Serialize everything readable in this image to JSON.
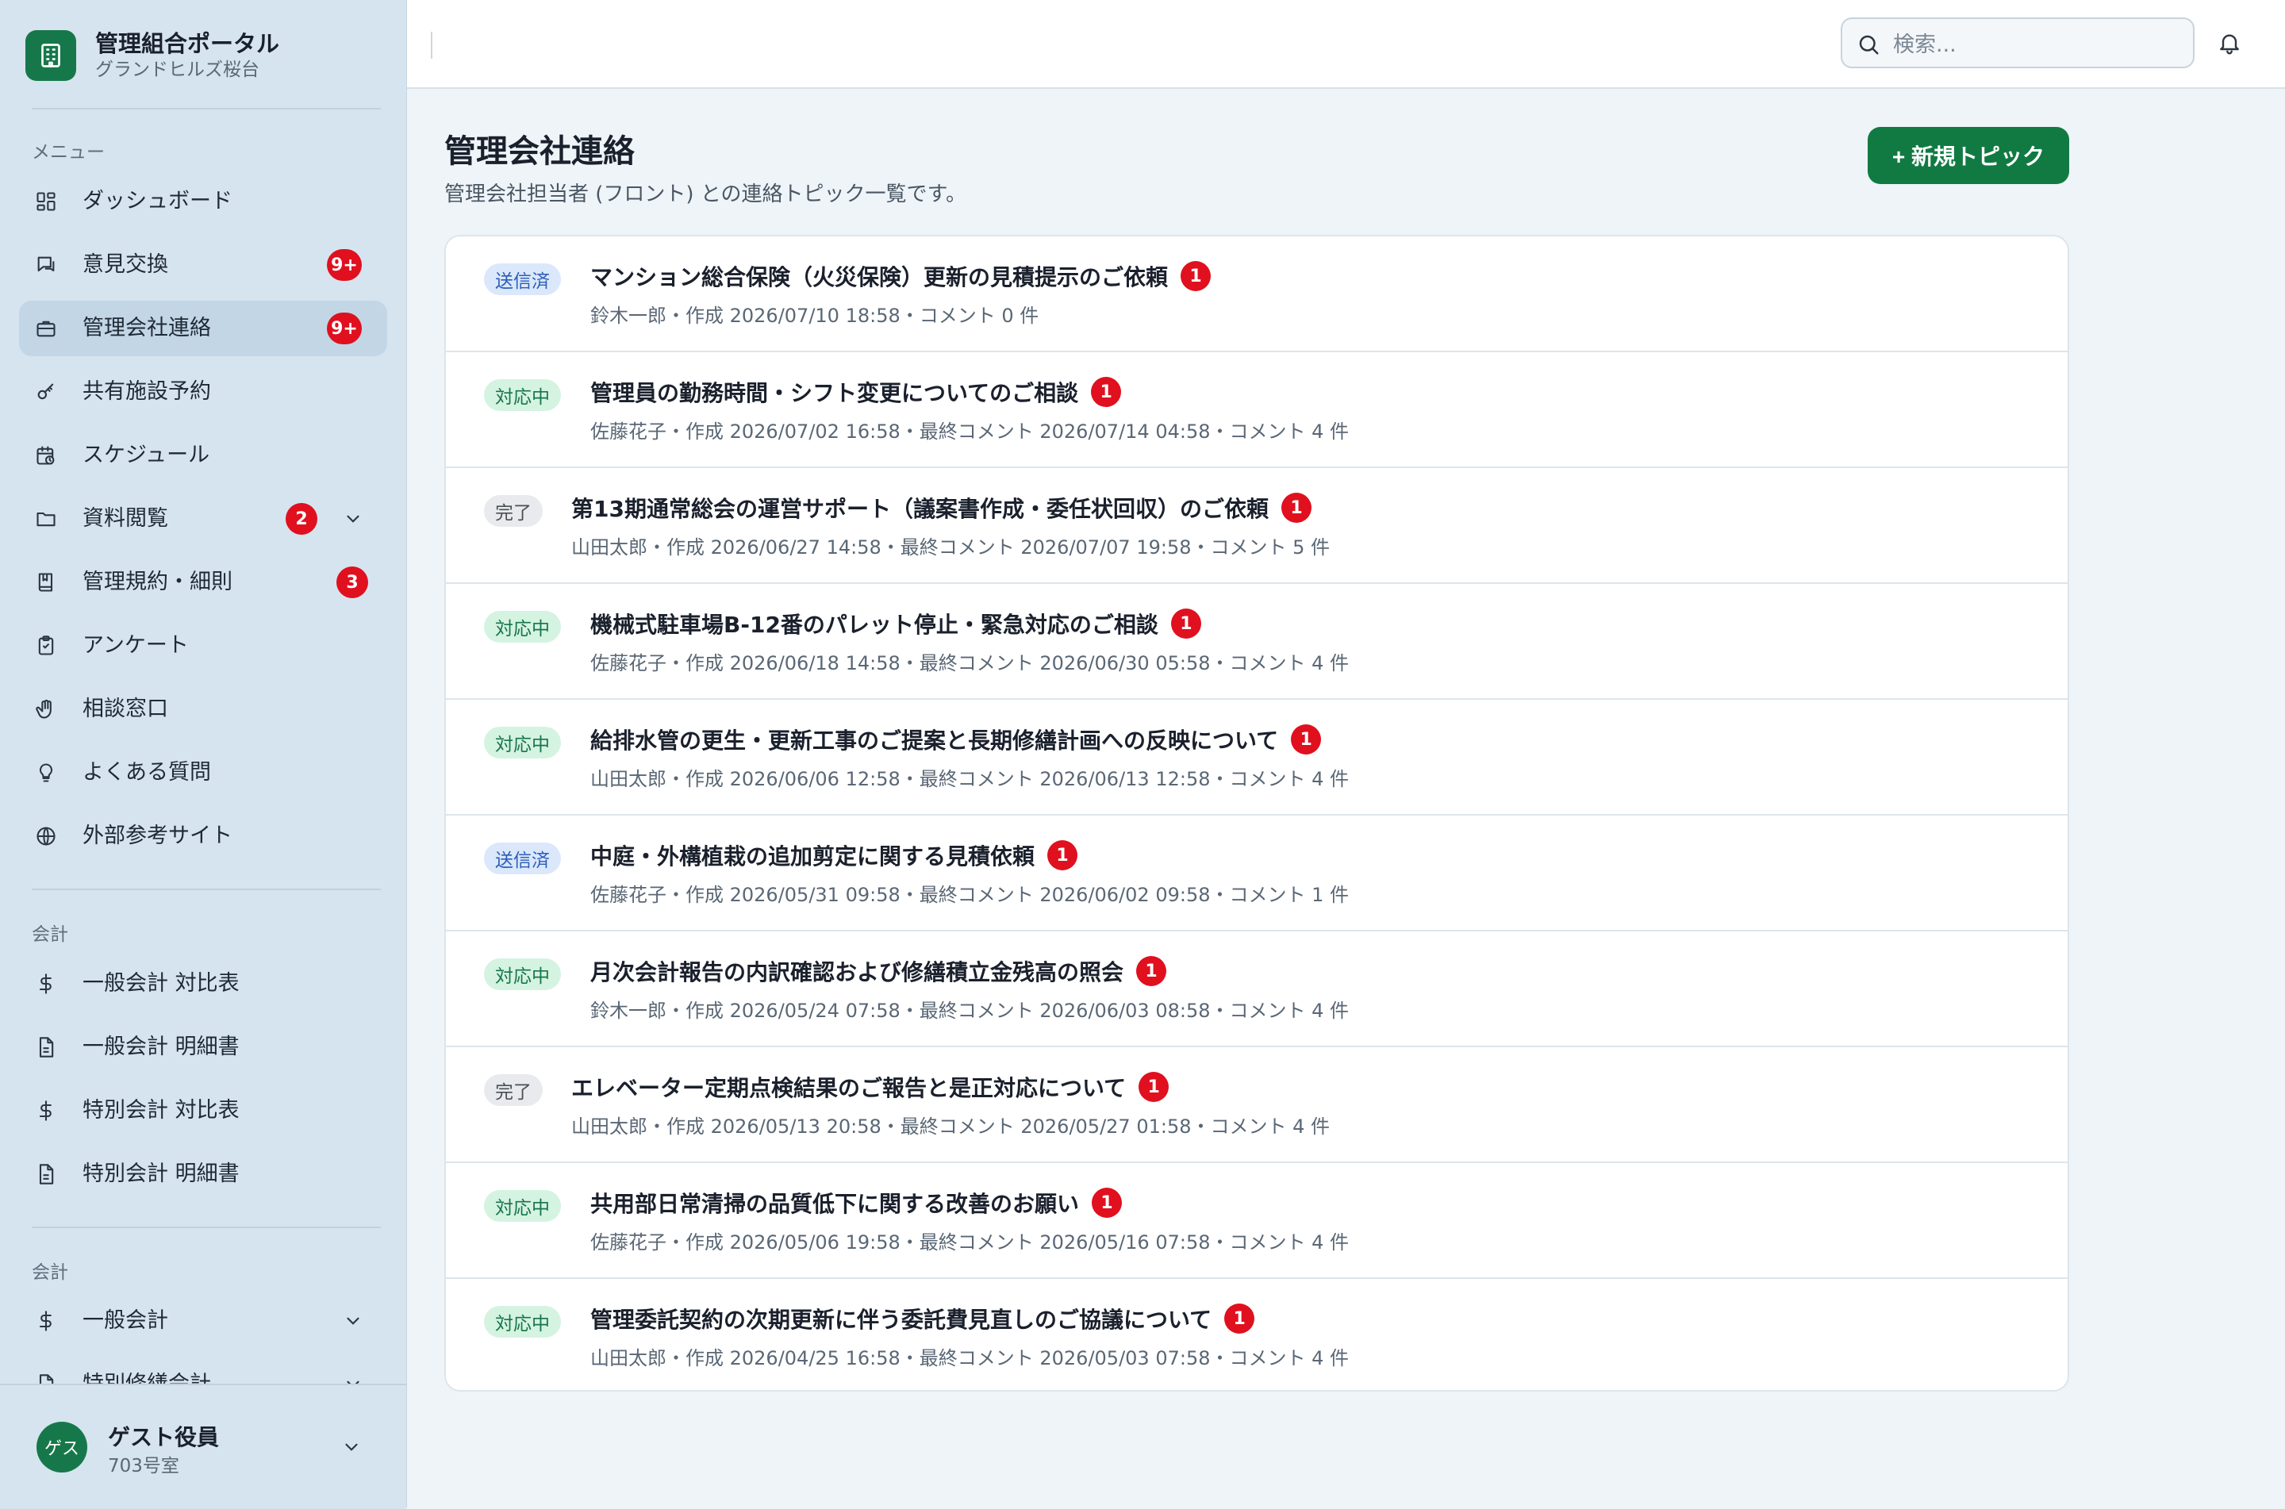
{
  "brand": {
    "title": "管理組合ポータル",
    "subtitle": "グランドヒルズ桜台"
  },
  "sidebar": {
    "menu_label": "メニュー",
    "items": [
      {
        "label": "ダッシュボード",
        "icon": "dashboard-icon"
      },
      {
        "label": "意見交換",
        "icon": "chat-icon",
        "badge": "9+"
      },
      {
        "label": "管理会社連絡",
        "icon": "briefcase-icon",
        "badge": "9+",
        "active": true
      },
      {
        "label": "共有施設予約",
        "icon": "key-icon"
      },
      {
        "label": "スケジュール",
        "icon": "calendar-clock-icon"
      },
      {
        "label": "資料閲覧",
        "icon": "folder-icon",
        "badge": "2"
      },
      {
        "label": "管理規約・細則",
        "icon": "book-icon",
        "badge": "3"
      },
      {
        "label": "アンケート",
        "icon": "clipboard-icon"
      },
      {
        "label": "相談窓口",
        "icon": "hand-icon"
      },
      {
        "label": "よくある質問",
        "icon": "lightbulb-icon"
      },
      {
        "label": "外部参考サイト",
        "icon": "globe-icon"
      }
    ],
    "accounting_label_1": "会計",
    "accounting_items": [
      {
        "label": "一般会計 対比表",
        "icon": "dollar-icon"
      },
      {
        "label": "一般会計 明細書",
        "icon": "document-icon"
      },
      {
        "label": "特別会計 対比表",
        "icon": "dollar-icon"
      },
      {
        "label": "特別会計 明細書",
        "icon": "document-icon"
      }
    ],
    "accounting_label_2": "会計",
    "accounting_group_items": [
      {
        "label": "一般会計",
        "icon": "dollar-icon"
      },
      {
        "label": "特別修繕会計",
        "icon": "document-icon"
      }
    ]
  },
  "user": {
    "avatar": "ゲス",
    "name": "ゲスト役員",
    "room": "703号室"
  },
  "search": {
    "placeholder": "検索..."
  },
  "main": {
    "title": "管理会社連絡",
    "subtitle": "管理会社担当者 (フロント) との連絡トピック一覧です。",
    "new_button": "+ 新規トピック"
  },
  "topics": [
    {
      "status": "送信済",
      "status_type": "sent",
      "title": "マンション総合保険（火災保険）更新の見積提示のご依頼",
      "count": "1",
      "meta": "鈴木一郎・作成 2026/07/10 18:58・コメント 0 件"
    },
    {
      "status": "対応中",
      "status_type": "prog",
      "title": "管理員の勤務時間・シフト変更についてのご相談",
      "count": "1",
      "meta": "佐藤花子・作成 2026/07/02 16:58・最終コメント 2026/07/14 04:58・コメント 4 件"
    },
    {
      "status": "完了",
      "status_type": "done",
      "title": "第13期通常総会の運営サポート（議案書作成・委任状回収）のご依頼",
      "count": "1",
      "meta": "山田太郎・作成 2026/06/27 14:58・最終コメント 2026/07/07 19:58・コメント 5 件"
    },
    {
      "status": "対応中",
      "status_type": "prog",
      "title": "機械式駐車場B-12番のパレット停止・緊急対応のご相談",
      "count": "1",
      "meta": "佐藤花子・作成 2026/06/18 14:58・最終コメント 2026/06/30 05:58・コメント 4 件"
    },
    {
      "status": "対応中",
      "status_type": "prog",
      "title": "給排水管の更生・更新工事のご提案と長期修繕計画への反映について",
      "count": "1",
      "meta": "山田太郎・作成 2026/06/06 12:58・最終コメント 2026/06/13 12:58・コメント 4 件"
    },
    {
      "status": "送信済",
      "status_type": "sent",
      "title": "中庭・外構植栽の追加剪定に関する見積依頼",
      "count": "1",
      "meta": "佐藤花子・作成 2026/05/31 09:58・最終コメント 2026/06/02 09:58・コメント 1 件"
    },
    {
      "status": "対応中",
      "status_type": "prog",
      "title": "月次会計報告の内訳確認および修繕積立金残高の照会",
      "count": "1",
      "meta": "鈴木一郎・作成 2026/05/24 07:58・最終コメント 2026/06/03 08:58・コメント 4 件"
    },
    {
      "status": "完了",
      "status_type": "done",
      "title": "エレベーター定期点検結果のご報告と是正対応について",
      "count": "1",
      "meta": "山田太郎・作成 2026/05/13 20:58・最終コメント 2026/05/27 01:58・コメント 4 件"
    },
    {
      "status": "対応中",
      "status_type": "prog",
      "title": "共用部日常清掃の品質低下に関する改善のお願い",
      "count": "1",
      "meta": "佐藤花子・作成 2026/05/06 19:58・最終コメント 2026/05/16 07:58・コメント 4 件"
    },
    {
      "status": "対応中",
      "status_type": "prog",
      "title": "管理委託契約の次期更新に伴う委託費見直しのご協議について",
      "count": "1",
      "meta": "山田太郎・作成 2026/04/25 16:58・最終コメント 2026/05/03 07:58・コメント 4 件"
    }
  ]
}
